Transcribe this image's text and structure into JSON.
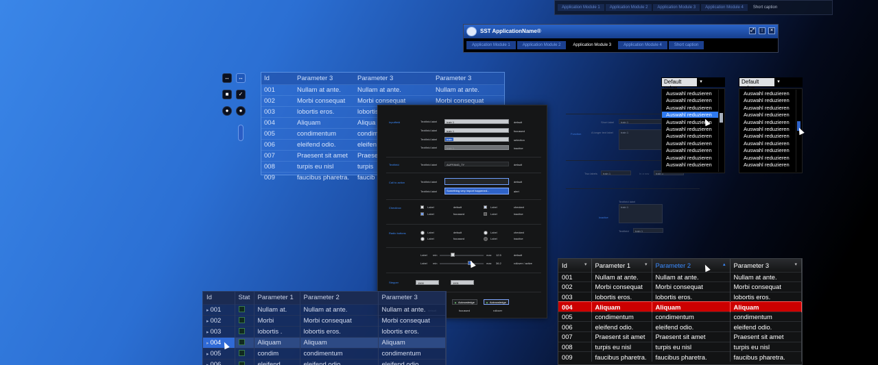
{
  "top_strip": {
    "tabs": [
      "Application Module 1",
      "Application Module 2",
      "Application Module 3",
      "Application Module 4",
      "Short caption"
    ],
    "selected_index": 4
  },
  "app_window": {
    "title": "SST ApplicationName®",
    "tabs": [
      "Application Module 1",
      "Application Module 2",
      "Application Module 3",
      "Application Module 4",
      "Short caption"
    ],
    "selected_index": 2,
    "window_buttons": [
      "⤢",
      "↕",
      "×"
    ]
  },
  "controls": {
    "toggle_dark": "↔",
    "toggle_blue": "↔",
    "checkbox_dark": "■",
    "checkbox_checked": "✓",
    "radio_dark": "●",
    "radio_selected": "●"
  },
  "table_a": {
    "headers": [
      "Id",
      "Parameter 3",
      "Parameter 3",
      "Parameter 3"
    ],
    "rows": [
      [
        "001",
        "Nullam at ante.",
        "Nullam at ante.",
        "Nullam at ante."
      ],
      [
        "002",
        "Morbi consequat",
        "Morbi consequat",
        "Morbi consequat"
      ],
      [
        "003",
        "lobortis eros.",
        "lobortis",
        ""
      ],
      [
        "004",
        "Aliquam",
        "Aliqua",
        ""
      ],
      [
        "005",
        "condimentum",
        "condim",
        ""
      ],
      [
        "006",
        "eleifend odio.",
        "eleifen",
        ""
      ],
      [
        "007",
        "Praesent sit amet",
        "Praese",
        ""
      ],
      [
        "008",
        "turpis eu nisl",
        "turpis",
        ""
      ],
      [
        "009",
        "faucibus pharetra.",
        "faucib",
        ""
      ]
    ]
  },
  "panel": {
    "sections": {
      "inputfield": "Inputfield",
      "textfield": "Textfield",
      "call_to_action": "Call to action",
      "checkbox": "Checkbox",
      "radio_buttons": "Radio buttons",
      "stepper": "Stepper",
      "buttons": "Buttons"
    },
    "textfield_label": "Textfield label",
    "train_value": "train 1",
    "selected_value": "train",
    "autofang_value": "AUFFANG_TY",
    "alert_value": "Something very import happened...",
    "states": {
      "default": "default",
      "focussed": "focussed",
      "selection": "selection",
      "inactive": "inactive",
      "alert": "alert",
      "checked": "checked",
      "rollover_active": "rollover / active",
      "rollover": "rollover"
    },
    "label": "Label",
    "slider_min": "min",
    "slider_max": "max",
    "slider_value_1": "12.5",
    "slider_value_2": "36.2",
    "stepper_value_1": "1500",
    "stepper_value_2": "1001",
    "button_label": "Acknowledge"
  },
  "ghost": {
    "short_label": "Short label",
    "longer_label": "A longer text label",
    "function": "Function",
    "two_labels": "Two labels",
    "in_a_row": "In a row",
    "textfield_label": "Textfield label",
    "inactive": "Inactive",
    "textfield": "Textfield",
    "train": "train 1"
  },
  "dropdown_1": {
    "value": "Default value",
    "items": [
      "Auswahl reduzieren",
      "Auswahl reduzieren",
      "Auswahl reduzieren",
      "Auswahl reduzieren",
      "Auswahl reduzieren",
      "Auswahl reduzieren",
      "Auswahl reduzieren",
      "Auswahl reduzieren",
      "Auswahl reduzieren",
      "Auswahl reduzieren",
      "Auswahl reduzieren"
    ],
    "highlighted_index": 3
  },
  "dropdown_2": {
    "value": "Default value",
    "items": [
      "Auswahl reduzieren",
      "Auswahl reduzieren",
      "Auswahl reduzieren",
      "Auswahl reduzieren",
      "Auswahl reduzieren",
      "Auswahl reduzieren",
      "Auswahl reduzieren",
      "Auswahl reduzieren",
      "Auswahl reduzieren",
      "Auswahl reduzieren",
      "Auswahl reduzieren"
    ]
  },
  "table_left": {
    "headers": [
      "Id",
      "Stat",
      "Parameter 1",
      "Parameter 2",
      "Parameter 3"
    ],
    "rows": [
      [
        "001",
        "",
        "Nullam at.",
        "Nullam at ante.",
        "Nullam at ante."
      ],
      [
        "002",
        "",
        "Morbi",
        "Morbi consequat",
        "Morbi consequat"
      ],
      [
        "003",
        "",
        "lobortis .",
        "lobortis eros.",
        "lobortis eros."
      ],
      [
        "004",
        "",
        "Aliquam",
        "Aliquam",
        "Aliquam"
      ],
      [
        "005",
        "",
        "condim",
        "condimentum",
        "condimentum"
      ],
      [
        "006",
        "",
        "eleifend",
        "eleifend odio.",
        "eleifend odio."
      ]
    ],
    "selected_index": 3
  },
  "table_right": {
    "headers": [
      "Id",
      "Parameter 1",
      "Parameter 2",
      "Parameter 3"
    ],
    "active_header": 2,
    "rows": [
      [
        "001",
        "Nullam at ante.",
        "Nullam at ante.",
        "Nullam at ante."
      ],
      [
        "002",
        "Morbi consequat",
        "Morbi consequat",
        "Morbi consequat"
      ],
      [
        "003",
        "lobortis eros.",
        "lobortis eros.",
        "lobortis eros."
      ],
      [
        "004",
        "Aliquam",
        "Aliquam",
        "Aliquam"
      ],
      [
        "005",
        "condimentum",
        "condimentum",
        "condimentum"
      ],
      [
        "006",
        "eleifend odio.",
        "eleifend odio.",
        "eleifend odio."
      ],
      [
        "007",
        "Praesent sit amet",
        "Praesent sit amet",
        "Praesent sit amet"
      ],
      [
        "008",
        "turpis eu nisl",
        "turpis eu nisl",
        "turpis eu nisl"
      ],
      [
        "009",
        "faucibus pharetra.",
        "faucibus pharetra.",
        "faucibus pharetra."
      ]
    ],
    "selected_index": 3,
    "selected_color": "#cc0000"
  }
}
